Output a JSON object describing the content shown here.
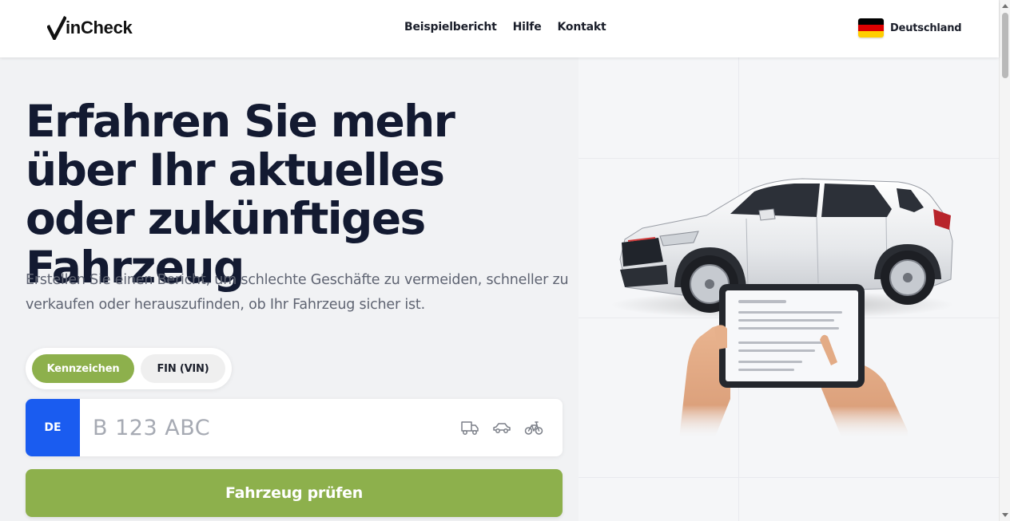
{
  "header": {
    "logo_text": "inCheck",
    "nav": [
      {
        "label": "Beispielbericht"
      },
      {
        "label": "Hilfe"
      },
      {
        "label": "Kontakt"
      }
    ],
    "country_label": "Deutschland",
    "flag_colors": [
      "#000000",
      "#dd0000",
      "#ffce00"
    ]
  },
  "hero": {
    "title": "Erfahren Sie mehr über Ihr aktuelles oder zukünftiges Fahrzeug",
    "subtitle": "Erstellen Sie einen Bericht, um schlechte Geschäfte zu vermeiden, schneller zu verkaufen oder herauszufinden, ob Ihr Fahrzeug sicher ist."
  },
  "search": {
    "tabs": [
      {
        "label": "Kennzeichen",
        "active": true
      },
      {
        "label": "FIN (VIN)",
        "active": false
      }
    ],
    "plate_country": "DE",
    "plate_placeholder": "B 123 ABC",
    "plate_value": "",
    "vehicle_icons": [
      "truck-icon",
      "car-icon",
      "bicycle-icon"
    ],
    "submit_label": "Fahrzeug prüfen"
  },
  "colors": {
    "accent": "#8db04c",
    "plate_blue": "#1a5cf0",
    "title": "#131a31"
  }
}
